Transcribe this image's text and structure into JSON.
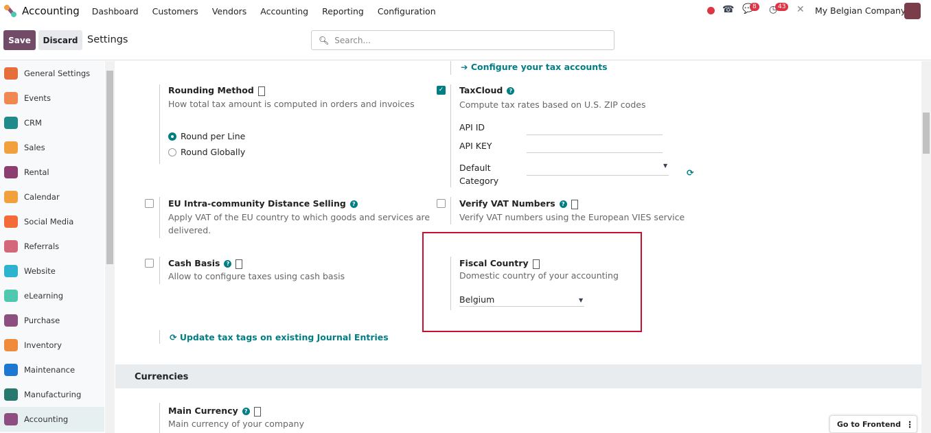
{
  "topbar": {
    "app": "Accounting",
    "menu": [
      "Dashboard",
      "Customers",
      "Vendors",
      "Accounting",
      "Reporting",
      "Configuration"
    ],
    "messages_count": "8",
    "activities_count": "43",
    "company": "My Belgian Company"
  },
  "control": {
    "save": "Save",
    "discard": "Discard",
    "title": "Settings",
    "search_placeholder": "Search..."
  },
  "sidebar": {
    "items": [
      {
        "label": "General Settings",
        "color": "#e46f3c"
      },
      {
        "label": "Events",
        "color": "#f0884f"
      },
      {
        "label": "CRM",
        "color": "#1f8a8a"
      },
      {
        "label": "Sales",
        "color": "#f0a03c"
      },
      {
        "label": "Rental",
        "color": "#8d3e70"
      },
      {
        "label": "Calendar",
        "color": "#f0a03c"
      },
      {
        "label": "Social Media",
        "color": "#f46b3a"
      },
      {
        "label": "Referrals",
        "color": "#d3687a"
      },
      {
        "label": "Website",
        "color": "#2bb3d0"
      },
      {
        "label": "eLearning",
        "color": "#4fc8b0"
      },
      {
        "label": "Purchase",
        "color": "#8d4e80"
      },
      {
        "label": "Inventory",
        "color": "#f08a3c"
      },
      {
        "label": "Maintenance",
        "color": "#1f78d0"
      },
      {
        "label": "Manufacturing",
        "color": "#27796e"
      },
      {
        "label": "Accounting",
        "color": "#8d4e80"
      }
    ]
  },
  "content": {
    "configure_link": "Configure your tax accounts",
    "rounding": {
      "title": "Rounding Method",
      "desc": "How total tax amount is computed in orders and invoices",
      "opt1": "Round per Line",
      "opt2": "Round Globally",
      "selected": "Round per Line"
    },
    "taxcloud": {
      "title": "TaxCloud",
      "desc": "Compute tax rates based on U.S. ZIP codes",
      "checked": true,
      "api_id": "API ID",
      "api_key": "API KEY",
      "default_cat1": "Default",
      "default_cat2": "Category"
    },
    "eu": {
      "title": "EU Intra-community Distance Selling",
      "desc1": "Apply VAT of the EU country to which goods and services are",
      "desc2": "delivered.",
      "checked": false
    },
    "vat": {
      "title": "Verify VAT Numbers",
      "desc": "Verify VAT numbers using the European VIES service",
      "checked": false
    },
    "cash": {
      "title": "Cash Basis",
      "desc": "Allow to configure taxes using cash basis",
      "checked": false
    },
    "fiscal": {
      "title": "Fiscal Country",
      "desc": "Domestic country of your accounting",
      "value": "Belgium"
    },
    "update_link": "Update tax tags on existing Journal Entries",
    "currencies": "Currencies",
    "main_currency": {
      "title": "Main Currency",
      "desc": "Main currency of your company"
    }
  },
  "frontend": "Go to Frontend",
  "highlight_color": "#c8102e"
}
